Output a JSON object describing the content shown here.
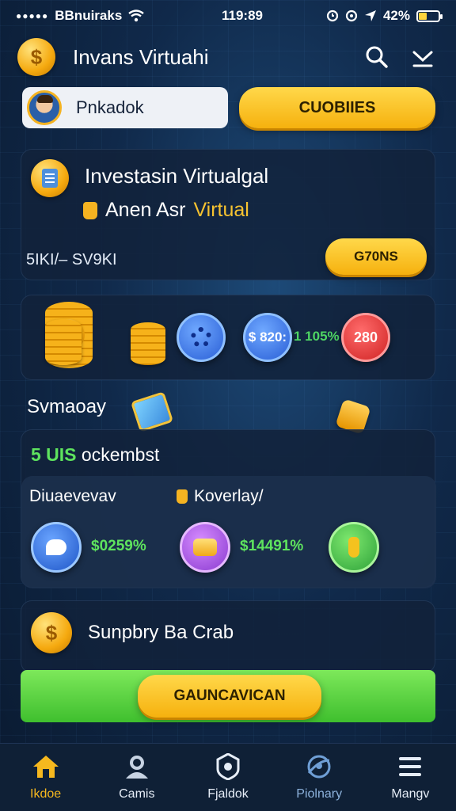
{
  "status_bar": {
    "carrier": "BBnuiraks",
    "time": "119:89",
    "battery": "42%",
    "battery_level": 0.42
  },
  "header": {
    "title": "Invans Virtuahi",
    "icons": [
      "dollar-coin-icon",
      "search-icon",
      "chevron-down-icon"
    ]
  },
  "profile": {
    "name": "Pnkadok"
  },
  "top_button": {
    "label": "CUOBIIES"
  },
  "investment_card": {
    "title": "Investasin Virtualgal",
    "subtitle_white": "Anen Asr",
    "subtitle_gold": "Virtual",
    "range": "5IKI/– SV9KI",
    "button_label": "G70NS"
  },
  "coins_row": {
    "pill_value": "$ 820:",
    "percent": "1 105%",
    "red_value": "280",
    "colors": {
      "gain": "#4ed563",
      "loss": "#d02424"
    }
  },
  "summary": {
    "label": "Svmaoay"
  },
  "portfolio_card": {
    "count": "5 UIS",
    "heading": "ockembst",
    "col1_label": "Diuaevevav",
    "col2_label": "Koverlay/",
    "items": [
      {
        "icon": "chat-icon",
        "value": "$0259%"
      },
      {
        "icon": "treasure-icon",
        "value": "$14491%"
      },
      {
        "icon": "drop-icon",
        "value": ""
      }
    ]
  },
  "club_card": {
    "title": "Sunpbry Ba Crab"
  },
  "bottom_button": {
    "label": "GAUNCAVICAN"
  },
  "tabbar": {
    "tabs": [
      {
        "label": "Ikdoe",
        "icon": "home-icon",
        "state": "active"
      },
      {
        "label": "Camis",
        "icon": "user-icon",
        "state": "normal"
      },
      {
        "label": "Fjaldok",
        "icon": "shield-icon",
        "state": "normal"
      },
      {
        "label": "Piolnary",
        "icon": "globe-icon",
        "state": "dim"
      },
      {
        "label": "Mangv",
        "icon": "menu-icon",
        "state": "normal"
      }
    ]
  },
  "colors": {
    "accent": "#f6b81e",
    "background": "#10294a",
    "positive": "#5ee35e",
    "cta_green": "#3fbf2e"
  }
}
